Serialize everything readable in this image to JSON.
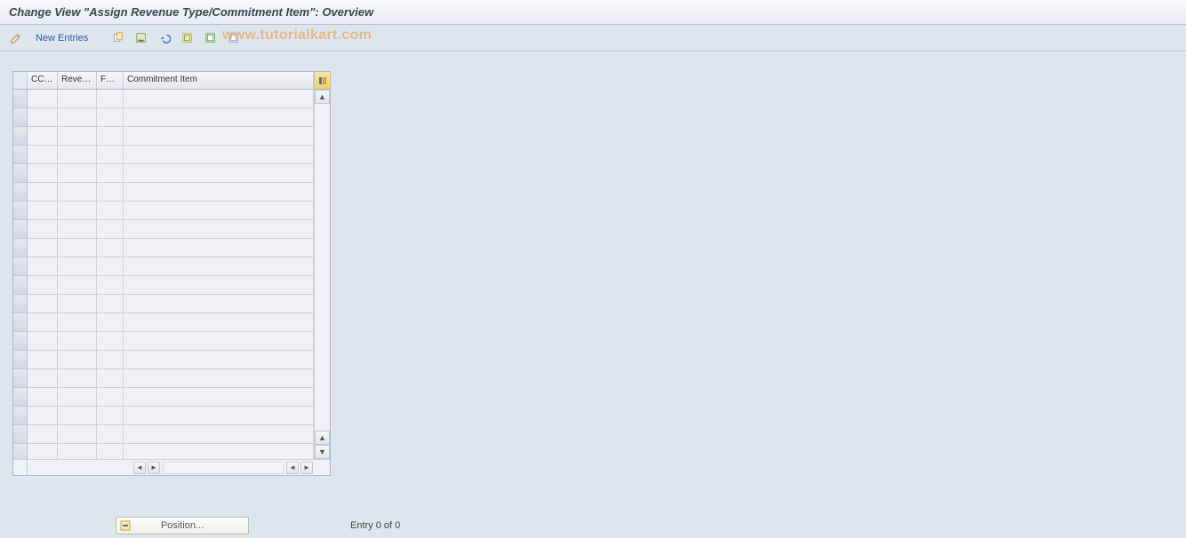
{
  "title": "Change View \"Assign Revenue Type/Commitment Item\": Overview",
  "toolbar": {
    "new_entries_label": "New Entries"
  },
  "watermark_text": "www.tutorialkart.com",
  "table": {
    "columns": [
      {
        "label": "CCGr",
        "width": 34
      },
      {
        "label": "Reven....",
        "width": 44
      },
      {
        "label": "FYID",
        "width": 30
      },
      {
        "label": "Commitment Item",
        "width": 180
      }
    ],
    "row_count": 20
  },
  "footer": {
    "position_label": "Position...",
    "entry_label": "Entry 0 of 0"
  }
}
